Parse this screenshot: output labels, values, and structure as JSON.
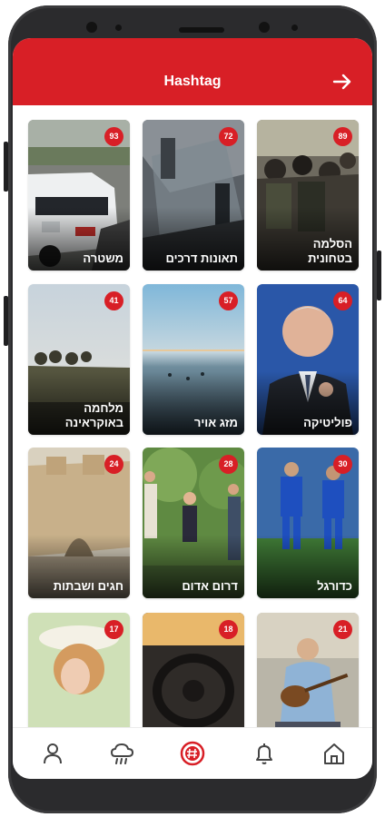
{
  "header": {
    "title": "Hashtag",
    "back_icon": "arrow-right-icon"
  },
  "accent_color": "#d81f26",
  "cards": [
    {
      "label": "משטרה",
      "count": "93"
    },
    {
      "label": "תאונות דרכים",
      "count": "72"
    },
    {
      "label": "הסלמה\nבטחונית",
      "count": "89"
    },
    {
      "label": "מלחמה\nבאוקראינה",
      "count": "41"
    },
    {
      "label": "מזג אויר",
      "count": "57"
    },
    {
      "label": "פוליטיקה",
      "count": "64"
    },
    {
      "label": "חגים ושבתות",
      "count": "24"
    },
    {
      "label": "דרום אדום",
      "count": "28"
    },
    {
      "label": "כדורגל",
      "count": "30"
    },
    {
      "label": "",
      "count": "17"
    },
    {
      "label": "",
      "count": "18"
    },
    {
      "label": "",
      "count": "21"
    }
  ],
  "bottom_nav": [
    {
      "icon": "user-icon"
    },
    {
      "icon": "weather-cloud-icon"
    },
    {
      "icon": "hashtag-icon",
      "active": true
    },
    {
      "icon": "bell-icon"
    },
    {
      "icon": "home-icon"
    }
  ]
}
